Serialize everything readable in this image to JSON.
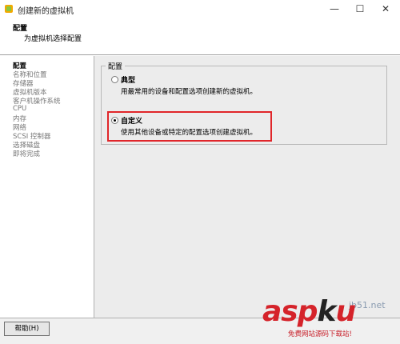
{
  "window": {
    "title": "创建新的虚拟机",
    "minimize": "—",
    "maximize": "☐",
    "close": "✕"
  },
  "header": {
    "title": "配置",
    "subtitle": "为虚拟机选择配置"
  },
  "nav": {
    "items": [
      {
        "label": "配置"
      },
      {
        "label": "名称和位置"
      },
      {
        "label": "存储器"
      },
      {
        "label": "虚拟机版本"
      },
      {
        "label": "客户机操作系统"
      },
      {
        "label": "CPU"
      },
      {
        "label": "内存"
      },
      {
        "label": "网络"
      },
      {
        "label": "SCSI 控制器"
      },
      {
        "label": "选择磁盘"
      },
      {
        "label": "即将完成"
      }
    ]
  },
  "config_group": {
    "legend": "配置",
    "options": [
      {
        "title": "典型",
        "description": "用最常用的设备和配置选项创建新的虚拟机。",
        "selected": false
      },
      {
        "title": "自定义",
        "description": "使用其他设备或特定的配置选项创建虚拟机。",
        "selected": true
      }
    ]
  },
  "footer": {
    "help_label": "帮助(H)"
  },
  "watermark": {
    "brand_asp": "asp",
    "brand_k": "k",
    "brand_u": "u",
    "tag": "jb51.net",
    "sub": "免费网站源码下载站!"
  },
  "colors": {
    "highlight": "#e0262a",
    "panel_bg": "#ececec"
  }
}
